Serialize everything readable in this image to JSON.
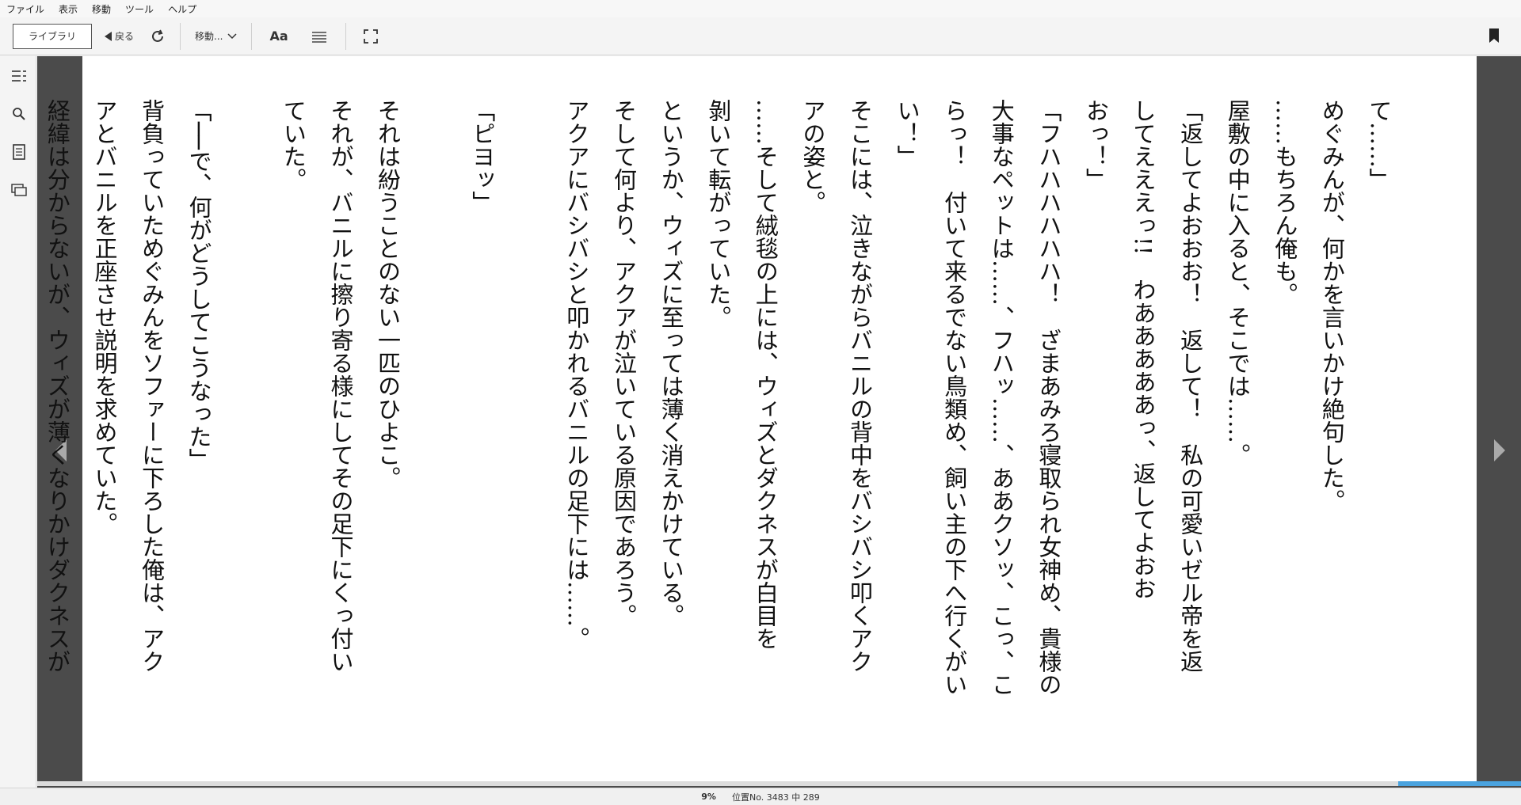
{
  "menu": {
    "items": [
      "ファイル",
      "表示",
      "移動",
      "ツール",
      "ヘルプ"
    ]
  },
  "toolbar": {
    "library_label": "ライブラリ",
    "back_label": "戻る",
    "goto_label": "移動...",
    "font_label": "Aa"
  },
  "book": {
    "columns": [
      "て……」",
      "めぐみんが、何かを言いかけ絶句した。",
      "……もちろん俺も。",
      "屋敷の中に入ると、そこでは……。",
      "「返してよおおお！　返して！　私の可愛いゼル帝を返",
      "してえええっ!!　わあああああっ、返してよおお",
      "おっ！」",
      "「フハハハハハハ！　ざまあみろ寝取られ女神め、貴様の",
      "大事なペットは……、フハッ……、ああクソッ、こっ、こ",
      "らっ！　付いて来るでない鳥類め、飼い主の下へ行くがい",
      "い！」",
      "そこには、泣きながらバニルの背中をバシバシ叩くアク",
      "アの姿と。",
      "……そして絨毯の上には、ウィズとダクネスが白目を",
      "剝いて転がっていた。",
      "というか、ウィズに至っては薄く消えかけている。",
      "そして何より、アクアが泣いている原因であろう。",
      "アクアにバシバシと叩かれるバニルの足下には……。",
      "",
      "「ピヨッ」",
      "",
      "それは紛うことのない一匹のひよこ。",
      "それが、バニルに擦り寄る様にしてその足下にくっ付い",
      "ていた。",
      "",
      "「──で、何がどうしてこうなった」",
      "背負っていためぐみんをソファーに下ろした俺は、アク",
      "アとバニルを正座させ説明を求めていた。",
      "経緯は分からないが、ウィズが薄くなりかけダクネスが"
    ]
  },
  "status": {
    "percent": "9%",
    "location": "位置No. 3483 中 289",
    "progress": 0.09
  },
  "colors": {
    "progress_fill": "#4aa3df",
    "reader_bg": "#4b4b4b"
  }
}
